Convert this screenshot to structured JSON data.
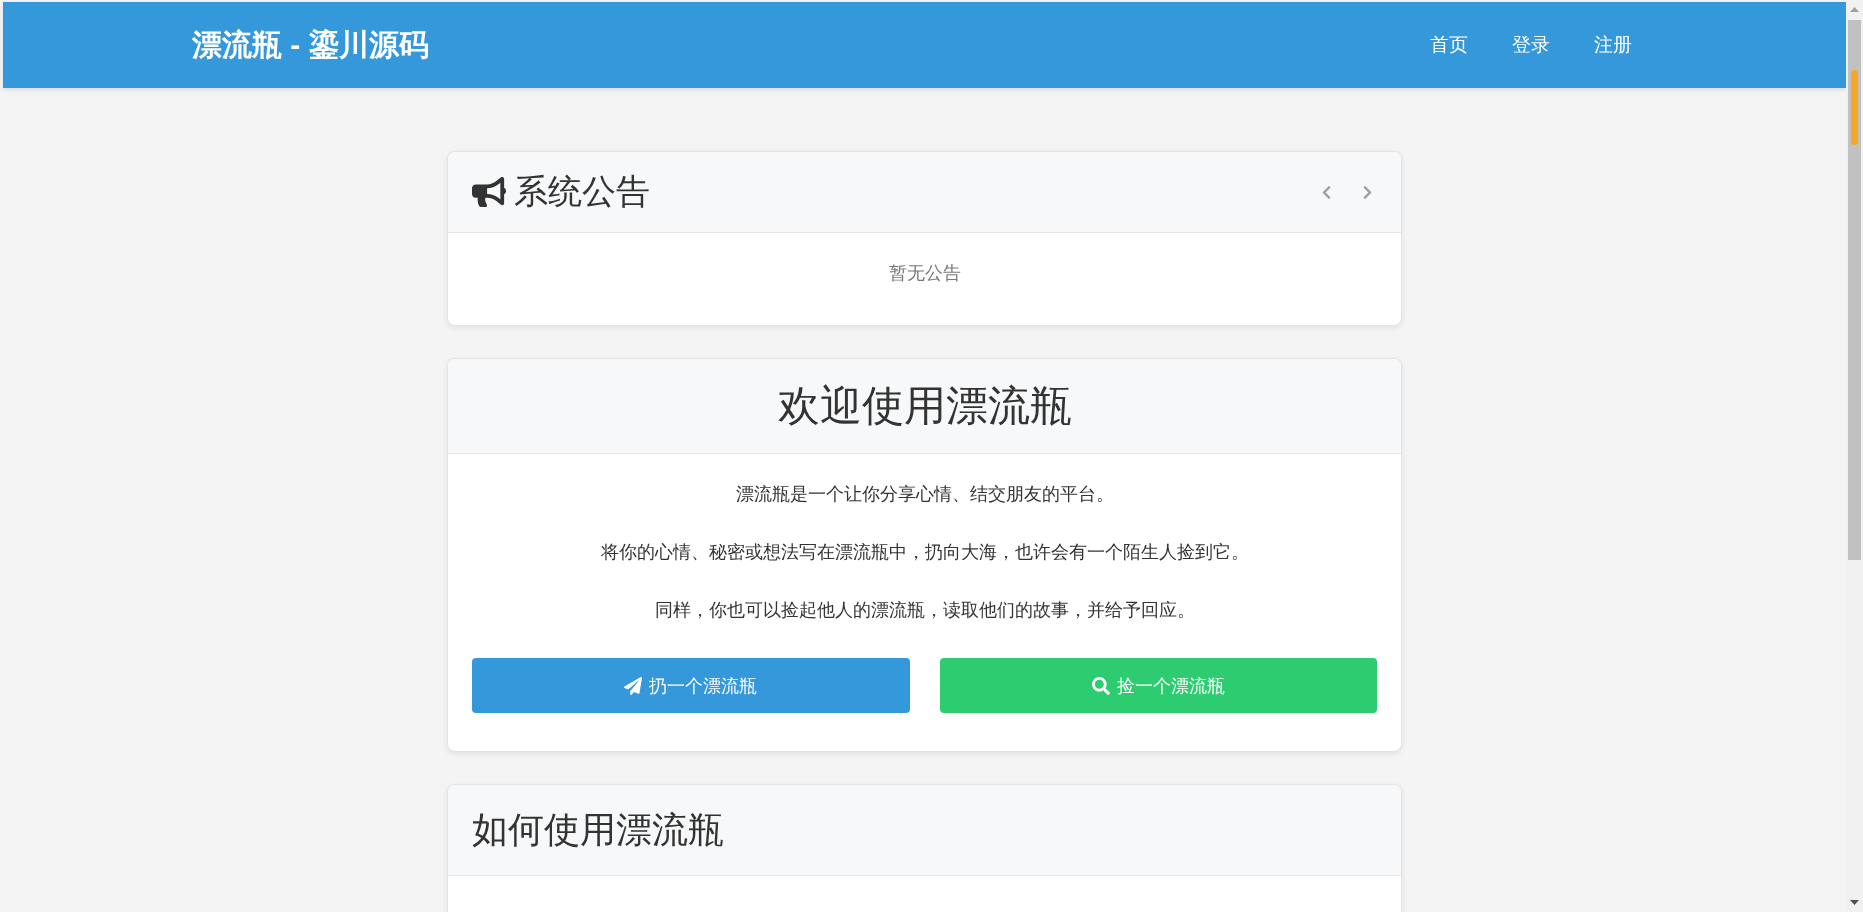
{
  "navbar": {
    "brand": "漂流瓶 - 鎏川源码",
    "links": [
      "首页",
      "登录",
      "注册"
    ]
  },
  "announcement": {
    "title": "系统公告",
    "empty_text": "暂无公告"
  },
  "welcome": {
    "title": "欢迎使用漂流瓶",
    "paragraphs": [
      "漂流瓶是一个让你分享心情、结交朋友的平台。",
      "将你的心情、秘密或想法写在漂流瓶中，扔向大海，也许会有一个陌生人捡到它。",
      "同样，你也可以捡起他人的漂流瓶，读取他们的故事，并给予回应。"
    ],
    "buttons": [
      {
        "label": "扔一个漂流瓶",
        "kind": "throw"
      },
      {
        "label": "捡一个漂流瓶",
        "kind": "pick"
      }
    ]
  },
  "howto": {
    "title": "如何使用漂流瓶"
  }
}
